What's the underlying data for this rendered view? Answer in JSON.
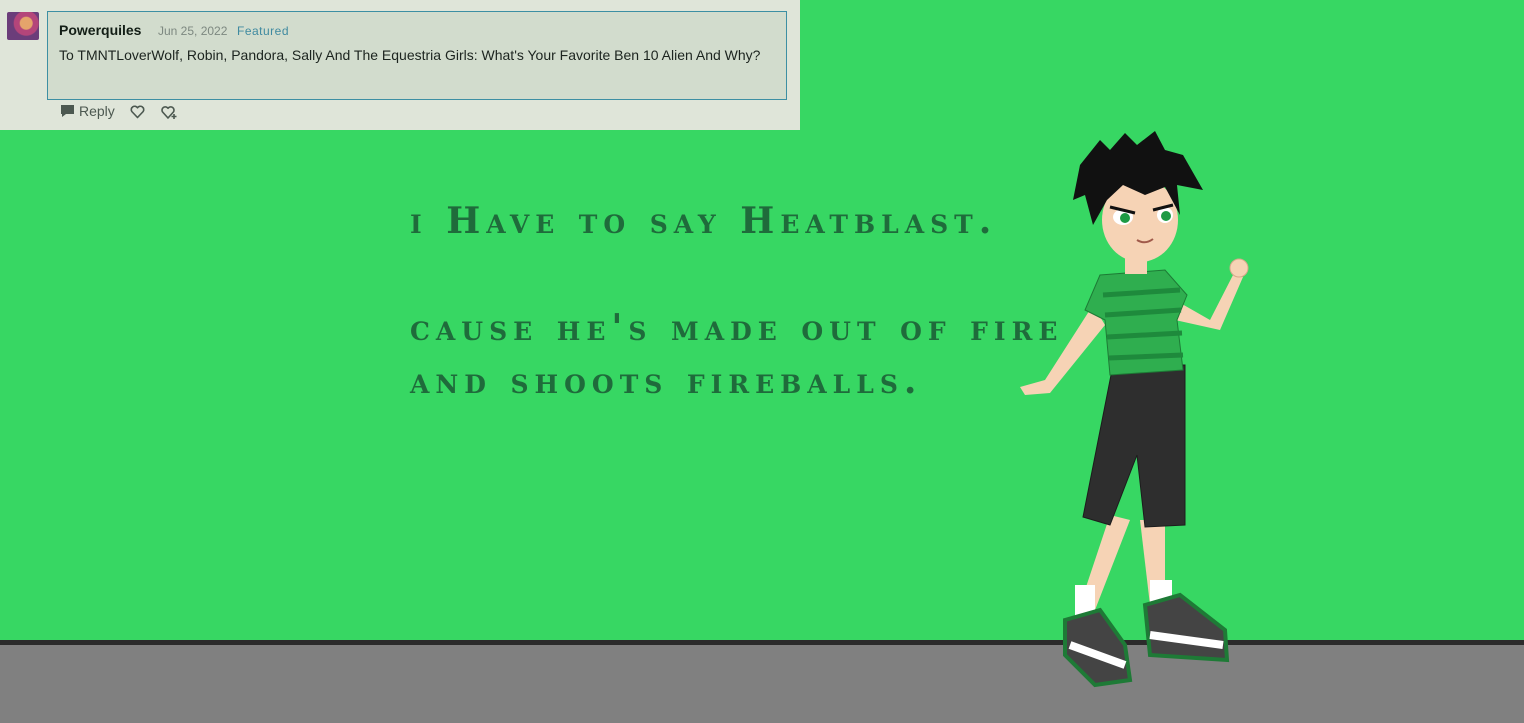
{
  "comment": {
    "username": "Powerquiles",
    "date": "Jun 25, 2022",
    "badge": "Featured",
    "text": "To TMNTLoverWolf, Robin, Pandora, Sally And The Equestria Girls: What's Your Favorite Ben 10 Alien And Why?"
  },
  "actions": {
    "reply_label": "Reply"
  },
  "answer": {
    "line1": "i Have to say Heatblast.",
    "line2": "cause he's made out of fire",
    "line3": "and shoots fireballs."
  },
  "colors": {
    "background": "#37d763",
    "floor": "#808080",
    "answer_text": "#1f6b3b",
    "comment_border": "#3d8fa3"
  }
}
